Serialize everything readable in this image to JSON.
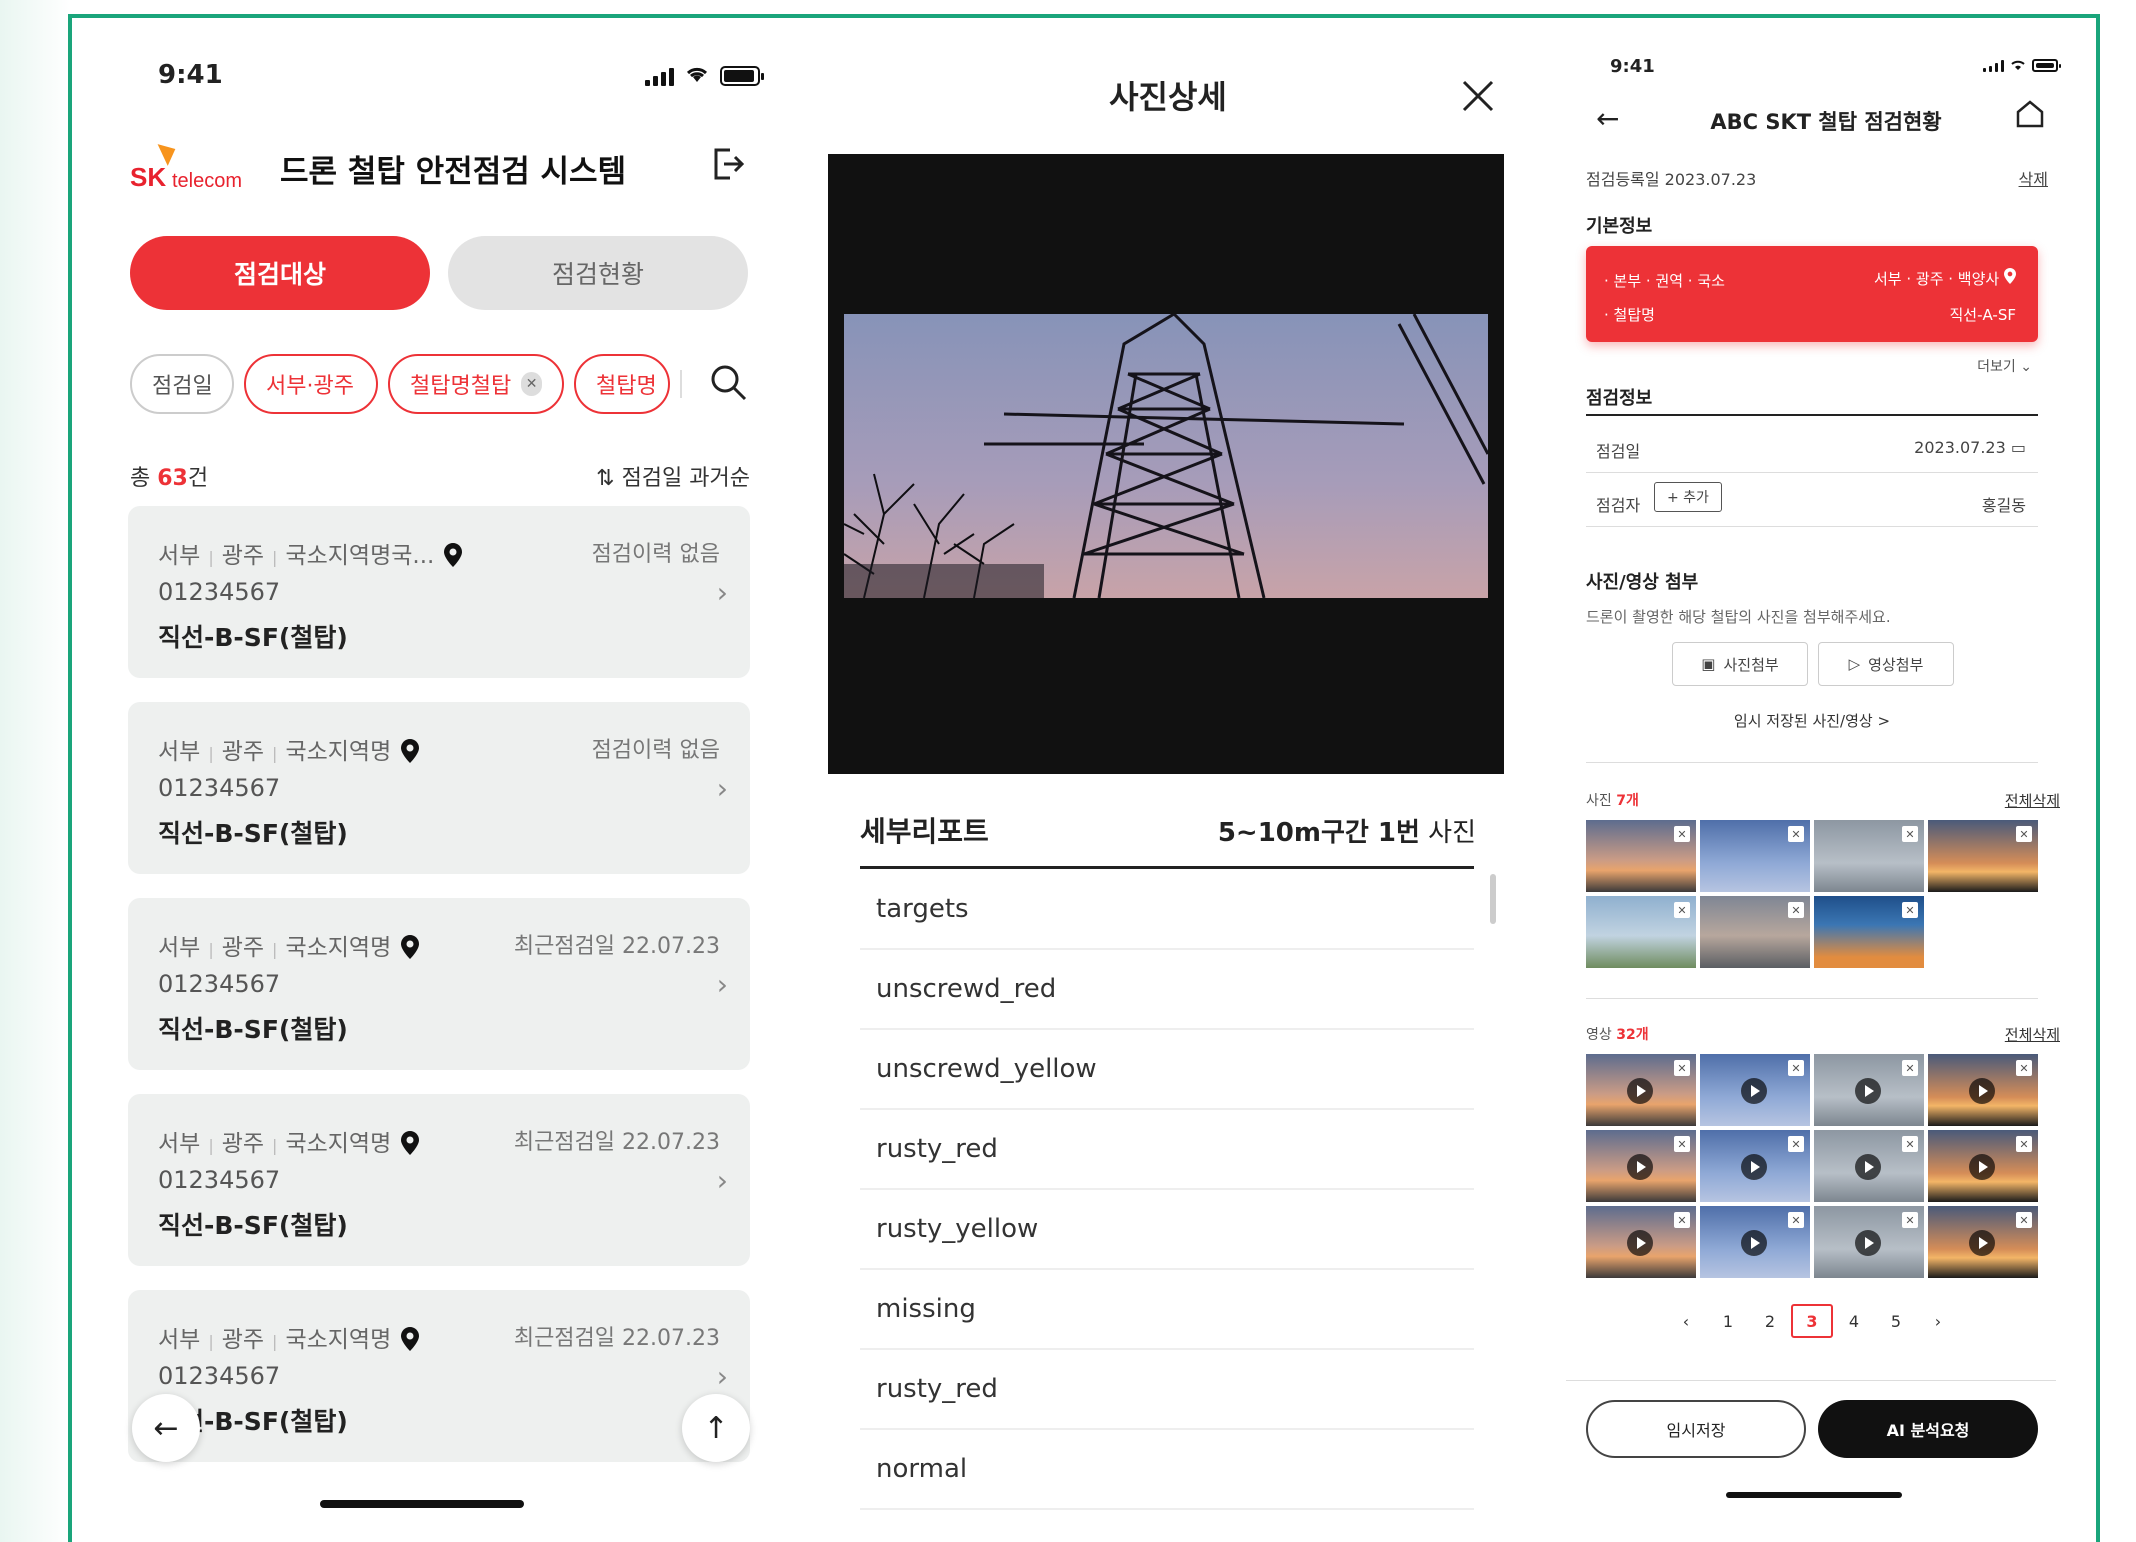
{
  "colors": {
    "accent": "#ed3237",
    "frame": "#1aa57b",
    "dark": "#111111"
  },
  "p1": {
    "time": "9:41",
    "logo_sk": "SK",
    "logo_tel": "telecom",
    "title": "드론 철탑 안전점검 시스템",
    "tab_active": "점검대상",
    "tab_inactive": "점검현황",
    "chips": [
      "점검일",
      "서부·광주",
      "철탑명철탑",
      "철탑명"
    ],
    "count_prefix": "총 ",
    "count_num": "63",
    "count_suffix": "건",
    "sort_label": "점검일 과거순",
    "cards": [
      {
        "region": "서부",
        "city": "광주",
        "site": "국소지역명국...",
        "status": "점검이력 없음",
        "code": "01234567",
        "name": "직선-B-SF(철탑)"
      },
      {
        "region": "서부",
        "city": "광주",
        "site": "국소지역명",
        "status": "점검이력 없음",
        "code": "01234567",
        "name": "직선-B-SF(철탑)"
      },
      {
        "region": "서부",
        "city": "광주",
        "site": "국소지역명",
        "status": "최근점검일 22.07.23",
        "code": "01234567",
        "name": "직선-B-SF(철탑)"
      },
      {
        "region": "서부",
        "city": "광주",
        "site": "국소지역명",
        "status": "최근점검일 22.07.23",
        "code": "01234567",
        "name": "직선-B-SF(철탑)"
      },
      {
        "region": "서부",
        "city": "광주",
        "site": "국소지역명",
        "status": "최근점검일 22.07.23",
        "code": "01234567",
        "name": "직선-B-SF(철탑)"
      }
    ]
  },
  "p2": {
    "title": "사진상세",
    "report_title": "세부리포트",
    "range_text": "5~10m구간 ",
    "photo_no": "1번",
    "photo_suffix": " 사진",
    "items": [
      "targets",
      "unscrewd_red",
      "unscrewd_yellow",
      "rusty_red",
      "rusty_yellow",
      "missing",
      "rusty_red",
      "normal"
    ]
  },
  "p3": {
    "time": "9:41",
    "title": "ABC SKT 철탑 점검현황",
    "reg_date": "점검등록일  2023.07.23",
    "delete": "삭제",
    "basic_info": "기본정보",
    "card_l1": "· 본부 · 권역 · 국소",
    "card_l2": "· 철탑명",
    "card_r1": "서부 · 광주 · 백양사",
    "card_r2": "직선-A-SF",
    "more": "더보기",
    "insp_info": "점검정보",
    "insp_date_label": "점검일",
    "insp_date": "2023.07.23",
    "inspector_label": "점검자",
    "add": "+ 추가",
    "inspector": "홍길동",
    "attach_title": "사진/영상 첨부",
    "attach_desc": "드론이 촬영한 해당 철탑의 사진을 첨부해주세요.",
    "photo_btn": "사진첨부",
    "video_btn": "영상첨부",
    "temp_saved": "임시 저장된 사진/영상 >",
    "photo_label": "사진 ",
    "photo_count": "7개",
    "video_label": "영상 ",
    "video_count": "32개",
    "delete_all": "전체삭제",
    "pages": [
      "1",
      "2",
      "3",
      "4",
      "5"
    ],
    "active_page": "3",
    "save_temp": "임시저장",
    "ai_request": "AI 분석요청"
  }
}
